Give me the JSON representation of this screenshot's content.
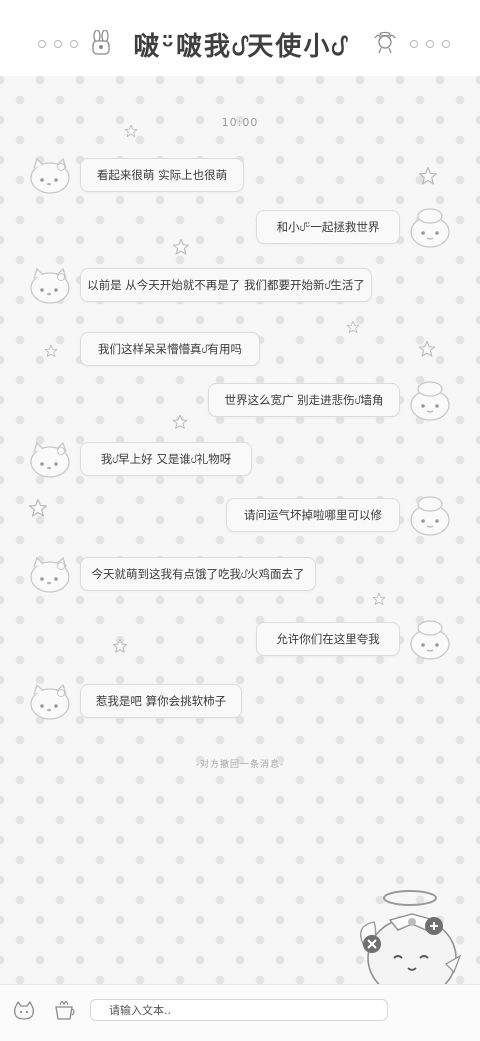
{
  "header": {
    "title": "啵ᵕ̈啵我ᦔ天使小ᦔ",
    "left_icon": "lock-bunny-icon",
    "right_icon": "angel-fairy-icon"
  },
  "chat": {
    "timestamp": "10:00",
    "messages": [
      {
        "side": "incoming",
        "text": "看起来很萌  实际上也很萌"
      },
      {
        "side": "outgoing",
        "text": "和小ᦔᵕ̈一起拯救世界"
      },
      {
        "side": "incoming",
        "text": "以前是  从今天开始就不再是了  我们都要开始新ᦔ生活了"
      },
      {
        "side": "incoming",
        "text": "我们这样呆呆懵懵真ᦔ有用吗"
      },
      {
        "side": "outgoing",
        "text": "世界这么宽广  别走进悲伤ᦔ墙角"
      },
      {
        "side": "incoming",
        "text": "我ᦔ早上好  又是谁ᦔ礼物呀"
      },
      {
        "side": "outgoing",
        "text": "请问运气坏掉啦哪里可以修"
      },
      {
        "side": "incoming",
        "text": "今天就萌到这我有点饿了吃我ᦔ火鸡面去了"
      },
      {
        "side": "outgoing",
        "text": "允许你们在这里夸我"
      },
      {
        "side": "incoming",
        "text": "惹我是吧  算你会挑软柿子"
      }
    ],
    "recall_notice": "-对方撤回一条消息-"
  },
  "input": {
    "placeholder": "请输入文本..",
    "left_icon": "cat-emoji-icon",
    "second_icon": "cup-icon"
  },
  "colors": {
    "background": "#f7f7f7",
    "dots": "#e3e3e3",
    "bubble": "#f9f9f9",
    "bubble_border": "#dcdcdc",
    "text": "#3b3b3b"
  }
}
